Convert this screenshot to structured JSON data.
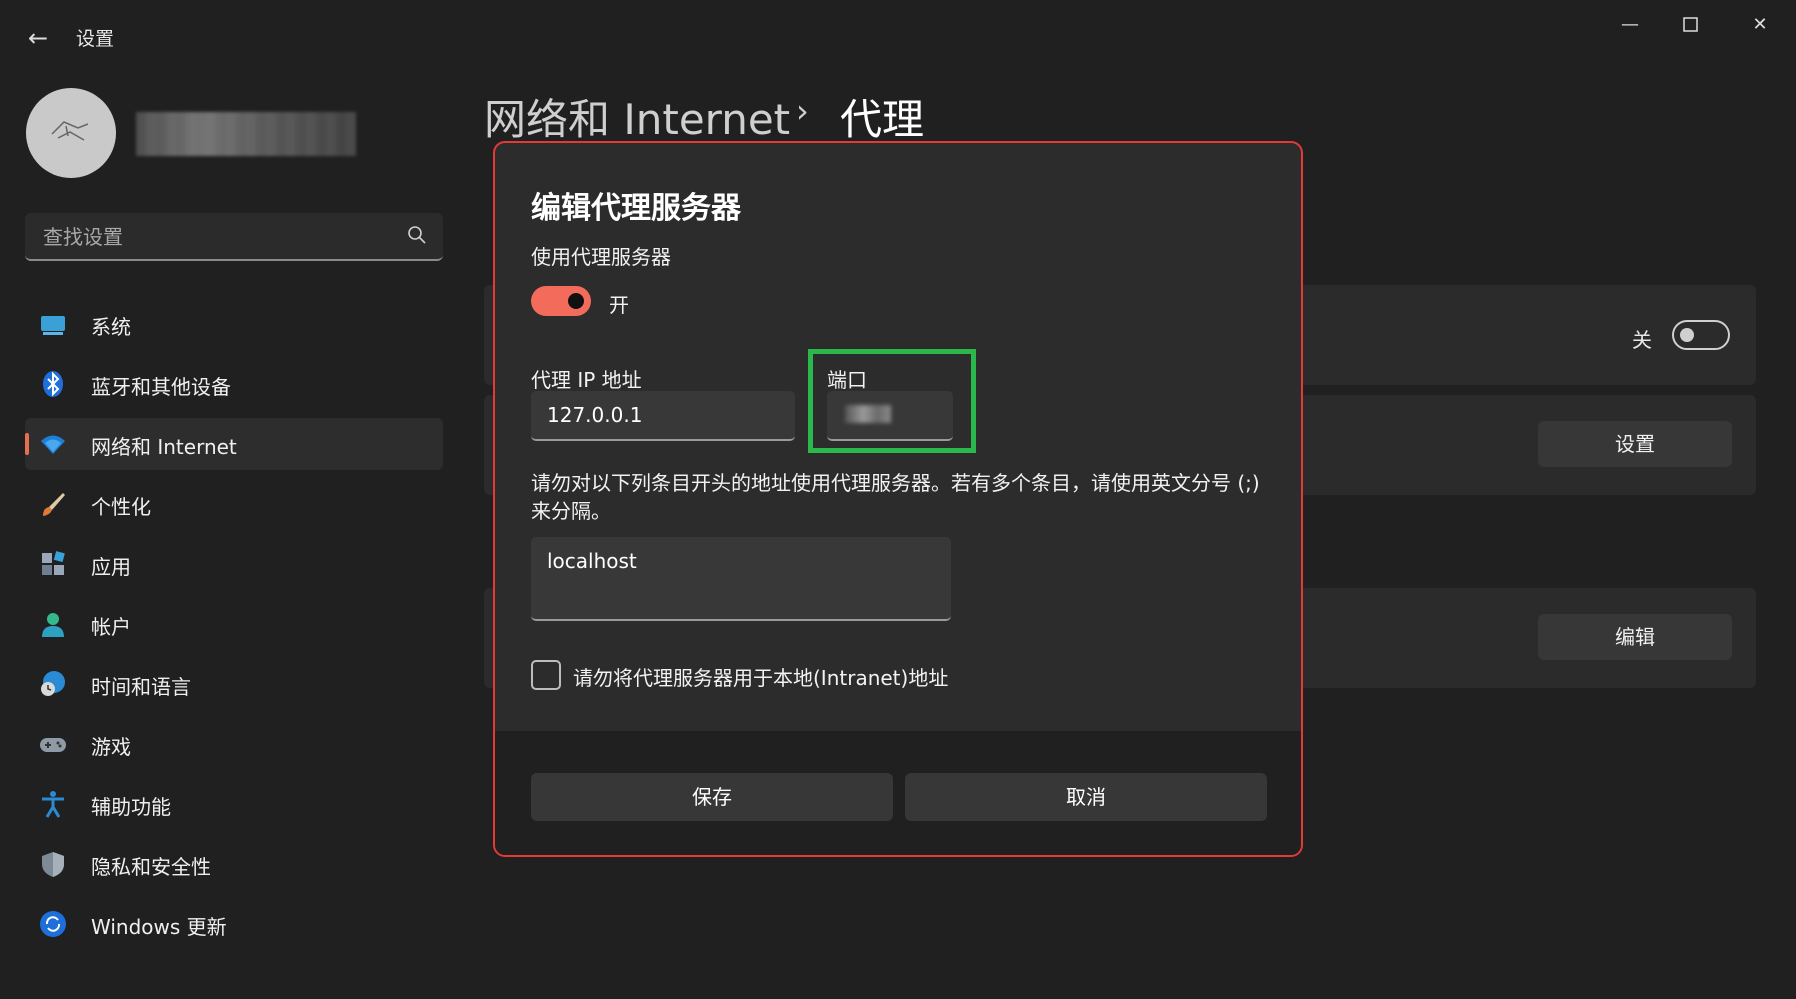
{
  "window": {
    "title": "设置",
    "controls": [
      "minimize",
      "maximize",
      "close"
    ]
  },
  "sidebar": {
    "search_placeholder": "查找设置",
    "items": [
      {
        "label": "系统",
        "icon": "monitor-icon"
      },
      {
        "label": "蓝牙和其他设备",
        "icon": "bluetooth-icon"
      },
      {
        "label": "网络和 Internet",
        "icon": "wifi-icon",
        "active": true
      },
      {
        "label": "个性化",
        "icon": "brush-icon"
      },
      {
        "label": "应用",
        "icon": "apps-icon"
      },
      {
        "label": "帐户",
        "icon": "person-icon"
      },
      {
        "label": "时间和语言",
        "icon": "globe-clock-icon"
      },
      {
        "label": "游戏",
        "icon": "gamepad-icon"
      },
      {
        "label": "辅助功能",
        "icon": "accessibility-icon"
      },
      {
        "label": "隐私和安全性",
        "icon": "shield-icon"
      },
      {
        "label": "Windows 更新",
        "icon": "update-icon"
      }
    ]
  },
  "header": {
    "breadcrumb_parent": "网络和 Internet",
    "separator": "›",
    "breadcrumb_current": "代理"
  },
  "background": {
    "auto_proxy_toggle_label": "关",
    "settings_button": "设置",
    "edit_button": "编辑"
  },
  "dialog": {
    "title": "编辑代理服务器",
    "use_proxy_label": "使用代理服务器",
    "toggle_state_label": "开",
    "ip_label": "代理 IP 地址",
    "ip_value": "127.0.0.1",
    "port_label": "端口",
    "exceptions_description": "请勿对以下列条目开头的地址使用代理服务器。若有多个条目，请使用英文分号 (;) 来分隔。",
    "exceptions_value": "localhost",
    "local_checkbox_label": "请勿将代理服务器用于本地(Intranet)地址",
    "save_button": "保存",
    "cancel_button": "取消"
  },
  "colors": {
    "accent": "#f26b5b",
    "dialog_outline": "#e53935",
    "port_highlight": "#2bb84a"
  }
}
